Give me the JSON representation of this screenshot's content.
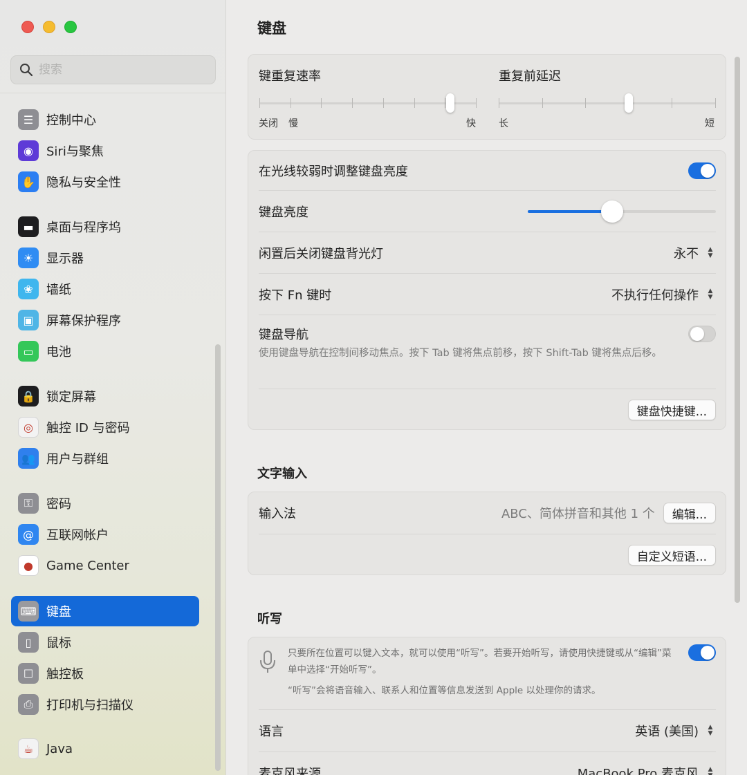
{
  "window": {
    "traffic_lights": {
      "close_color": "#ee5a52",
      "minimize_color": "#f5bc2f",
      "maximize_color": "#28c640"
    }
  },
  "sidebar": {
    "search_placeholder": "搜索",
    "items": [
      {
        "label": "控制中心",
        "icon": "control-center-icon",
        "color": "#8e8e93"
      },
      {
        "label": "Siri与聚焦",
        "icon": "siri-icon",
        "color": "#5e3bd7"
      },
      {
        "label": "隐私与安全性",
        "icon": "hand-icon",
        "color": "#2b7ef2"
      },
      {
        "label": "桌面与程序坞",
        "icon": "dock-icon",
        "color": "#1d1d1f"
      },
      {
        "label": "显示器",
        "icon": "sun-icon",
        "color": "#2f8cf3"
      },
      {
        "label": "墙纸",
        "icon": "flower-icon",
        "color": "#3fb6ee"
      },
      {
        "label": "屏幕保护程序",
        "icon": "screensaver-icon",
        "color": "#4fb5e6"
      },
      {
        "label": "电池",
        "icon": "battery-icon",
        "color": "#34c759"
      },
      {
        "label": "锁定屏幕",
        "icon": "lock-icon",
        "color": "#1d1d1f"
      },
      {
        "label": "触控 ID 与密码",
        "icon": "fingerprint-icon",
        "color": "#f3f3f3"
      },
      {
        "label": "用户与群组",
        "icon": "users-icon",
        "color": "#2f80ed"
      },
      {
        "label": "密码",
        "icon": "key-icon",
        "color": "#8e8e93"
      },
      {
        "label": "互联网帐户",
        "icon": "at-icon",
        "color": "#2f86f0"
      },
      {
        "label": "Game Center",
        "icon": "game-center-icon",
        "color": "#ffffff"
      },
      {
        "label": "键盘",
        "icon": "keyboard-icon",
        "color": "#9a9a9e",
        "active": true
      },
      {
        "label": "鼠标",
        "icon": "mouse-icon",
        "color": "#8e8e93"
      },
      {
        "label": "触控板",
        "icon": "trackpad-icon",
        "color": "#8e8e93"
      },
      {
        "label": "打印机与扫描仪",
        "icon": "printer-icon",
        "color": "#8e8e93"
      },
      {
        "label": "Java",
        "icon": "java-icon",
        "color": "#f3f3f3"
      }
    ]
  },
  "main": {
    "title": "键盘",
    "repeat": {
      "rate_label": "键重复速率",
      "rate_left_labels": [
        "关闭",
        "慢"
      ],
      "rate_right_label": "快",
      "rate_value_fraction": 0.88,
      "delay_label": "重复前延迟",
      "delay_left_label": "长",
      "delay_right_label": "短",
      "delay_value_fraction": 0.6
    },
    "settings": {
      "auto_brightness_label": "在光线较弱时调整键盘亮度",
      "auto_brightness_on": true,
      "brightness_label": "键盘亮度",
      "brightness_fraction": 0.45,
      "backlight_off_label": "闲置后关闭键盘背光灯",
      "backlight_off_value": "永不",
      "fn_label": "按下 Fn 键时",
      "fn_value": "不执行任何操作",
      "nav_label": "键盘导航",
      "nav_desc": "使用键盘导航在控制间移动焦点。按下 Tab 键将焦点前移，按下 Shift-Tab 键将焦点后移。",
      "nav_on": false,
      "shortcuts_button": "键盘快捷键..."
    },
    "text_input": {
      "section_title": "文字输入",
      "input_method_label": "输入法",
      "input_method_value": "ABC、简体拼音和其他 1 个",
      "edit_button": "编辑...",
      "custom_phrases_button": "自定义短语..."
    },
    "dictation": {
      "section_title": "听写",
      "desc1": "只要所在位置可以键入文本，就可以使用“听写”。若要开始听写，请使用快捷键或从“编辑”菜单中选择“开始听写”。",
      "desc2": "“听写”会将语音输入、联系人和位置等信息发送到 Apple 以处理你的请求。",
      "on": true,
      "language_label": "语言",
      "language_value": "英语 (美国)",
      "mic_label": "麦克风来源",
      "mic_value": "MacBook Pro 麦克风"
    }
  },
  "colors": {
    "accent": "#1a6fe0",
    "sidebar_selected": "#1469d8"
  }
}
